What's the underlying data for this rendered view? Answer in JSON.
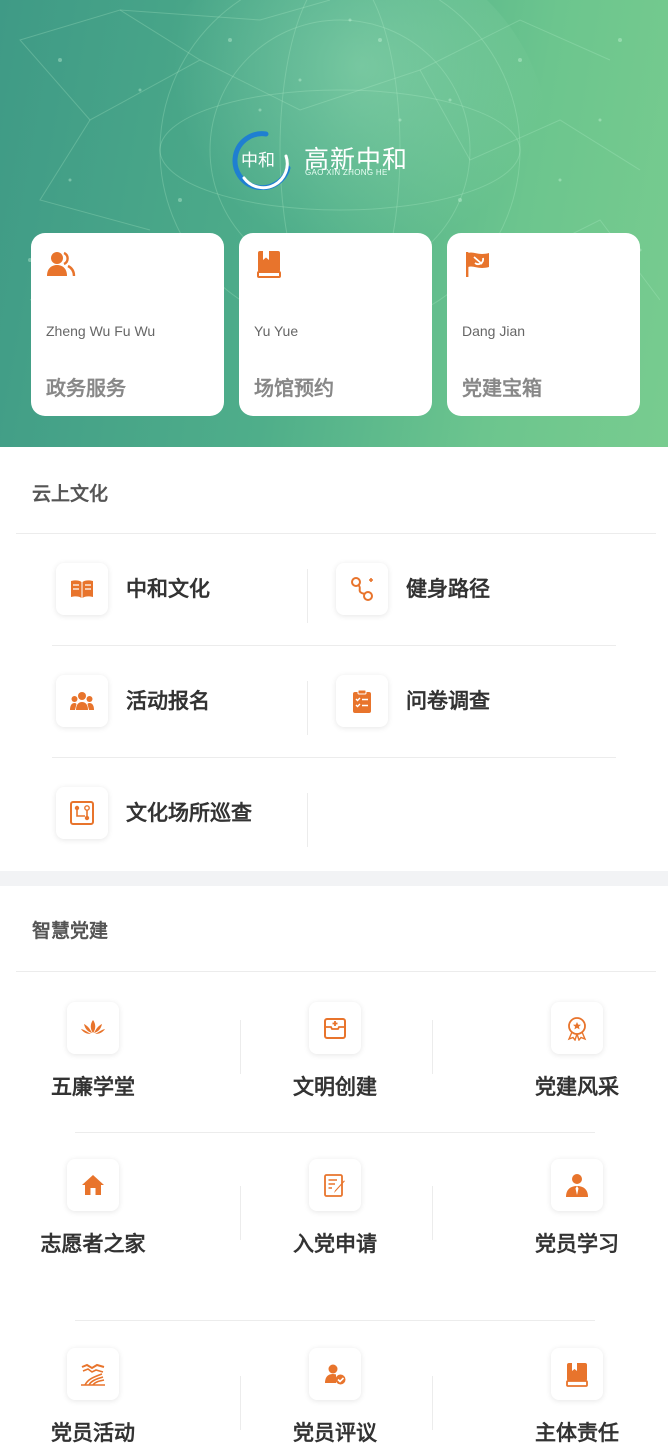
{
  "header": {
    "logo_mark_text": "中和",
    "logo_cn": "高新中和",
    "logo_en": "GAO XIN ZHONG HE"
  },
  "quick_cards": [
    {
      "icon": "users-icon",
      "pinyin": "Zheng Wu Fu Wu",
      "title": "政务服务"
    },
    {
      "icon": "book-icon",
      "pinyin": "Yu Yue",
      "title": "场馆预约"
    },
    {
      "icon": "party-flag-icon",
      "pinyin": "Dang Jian",
      "title": "党建宝箱"
    }
  ],
  "cloud_culture": {
    "title": "云上文化",
    "items": [
      {
        "icon": "open-book-icon",
        "label": "中和文化"
      },
      {
        "icon": "route-icon",
        "label": "健身路径"
      },
      {
        "icon": "group-icon",
        "label": "活动报名"
      },
      {
        "icon": "clipboard-checklist-icon",
        "label": "问卷调查"
      },
      {
        "icon": "flowchart-icon",
        "label": "文化场所巡查"
      }
    ]
  },
  "smart_party": {
    "title": "智慧党建",
    "items": [
      {
        "icon": "lotus-icon",
        "label": "五廉学堂"
      },
      {
        "icon": "medical-box-icon",
        "label": "文明创建"
      },
      {
        "icon": "award-badge-icon",
        "label": "党建风采"
      },
      {
        "icon": "home-icon",
        "label": "志愿者之家"
      },
      {
        "icon": "edit-document-icon",
        "label": "入党申请"
      },
      {
        "icon": "person-tie-icon",
        "label": "党员学习"
      },
      {
        "icon": "great-wall-icon",
        "label": "党员活动"
      },
      {
        "icon": "user-check-icon",
        "label": "党员评议"
      },
      {
        "icon": "book-bookmark-icon",
        "label": "主体责任"
      }
    ]
  },
  "colors": {
    "accent": "#e8742c",
    "header_start": "#3f9a86",
    "header_end": "#78cc8f",
    "party_red": "#e8742c"
  }
}
